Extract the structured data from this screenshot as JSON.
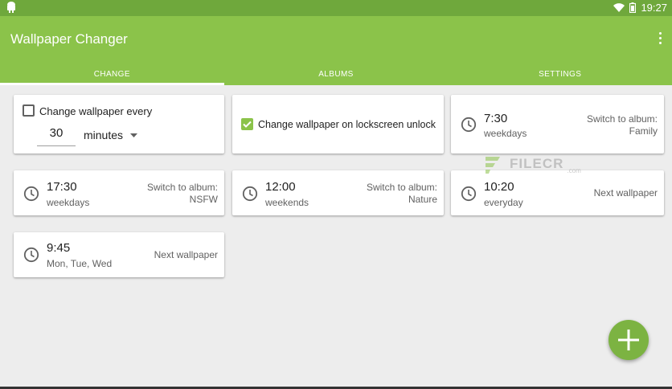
{
  "status_bar": {
    "time": "19:27"
  },
  "app_bar": {
    "title": "Wallpaper Changer"
  },
  "tabs": [
    {
      "label": "CHANGE",
      "active": true
    },
    {
      "label": "ALBUMS",
      "active": false
    },
    {
      "label": "SETTINGS",
      "active": false
    }
  ],
  "interval_card": {
    "checkbox_label": "Change wallpaper every",
    "checked": false,
    "value": "30",
    "unit": "minutes"
  },
  "lockscreen_card": {
    "label": "Change wallpaper on lockscreen unlock",
    "checked": true
  },
  "schedules": [
    {
      "time": "7:30",
      "days": "weekdays",
      "action": "Switch to album:",
      "target": "Family"
    },
    {
      "time": "17:30",
      "days": "weekdays",
      "action": "Switch to album:",
      "target": "NSFW"
    },
    {
      "time": "12:00",
      "days": "weekends",
      "action": "Switch to album:",
      "target": "Nature"
    },
    {
      "time": "10:20",
      "days": "everyday",
      "action": "Next wallpaper"
    },
    {
      "time": "9:45",
      "days": "Mon, Tue, Wed",
      "action": "Next wallpaper"
    }
  ],
  "watermark": {
    "text": "FILECR",
    "suffix": ".com"
  },
  "colors": {
    "primary": "#8bc34a",
    "status_bar": "#6fa83c",
    "fab": "#7cb342",
    "background": "#ededed"
  },
  "icons": [
    "android-icon",
    "wifi-icon",
    "battery-icon",
    "overflow-menu-icon",
    "clock-icon",
    "dropdown-arrow-icon",
    "add-icon"
  ]
}
